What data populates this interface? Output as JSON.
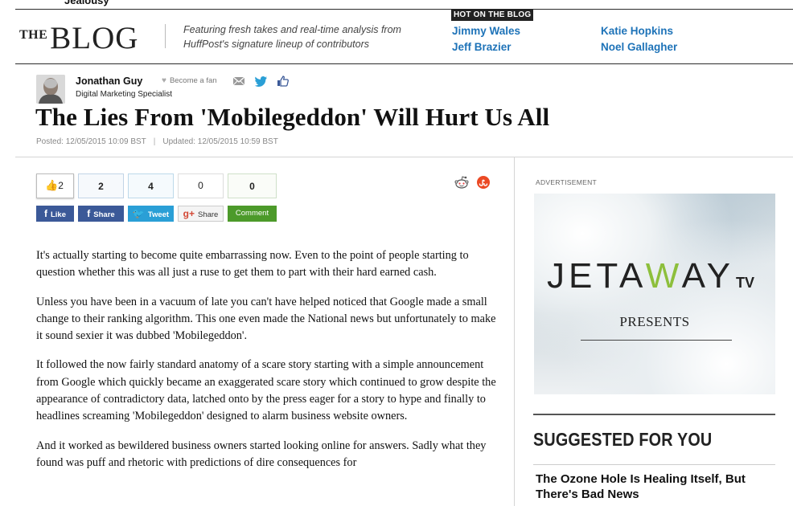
{
  "top_cut_text": "Jealousy",
  "header": {
    "brand_the": "THE",
    "brand_blog": "BLOG",
    "tagline": "Featuring fresh takes and real-time analysis from HuffPost's signature lineup of contributors",
    "hot_label": "HOT ON THE BLOG",
    "hot_links": [
      "Jimmy Wales",
      "Katie Hopkins",
      "Jeff Brazier",
      "Noel Gallagher"
    ]
  },
  "byline": {
    "author_name": "Jonathan Guy",
    "become_fan": "Become a fan",
    "author_title": "Digital Marketing Specialist"
  },
  "article": {
    "title": "The Lies From 'Mobilegeddon' Will Hurt Us All",
    "posted": "Posted: 12/05/2015 10:09 BST",
    "updated": "Updated: 12/05/2015 10:59 BST",
    "paragraphs": [
      "It's actually starting to become quite embarrassing now. Even to the point of people starting to question whether this was all just a ruse to get them to part with their hard earned cash.",
      "Unless you have been in a vacuum of late you can't have helped noticed that Google made a small change to their ranking algorithm. This one even made the National news but unfortunately to make it sound sexier it was dubbed 'Mobilegeddon'.",
      "It followed the now fairly standard anatomy of a scare story starting with a simple announcement from Google which quickly became an exaggerated scare story which continued to grow despite the appearance of contradictory data, latched onto by the press eager for a story to hype and finally to headlines screaming 'Mobilegeddon' designed to alarm business website owners.",
      "And it worked as bewildered business owners started looking online for answers. Sadly what they found was puff and rhetoric with predictions of dire consequences for"
    ]
  },
  "share": {
    "like_count": "2",
    "facebook_count": "2",
    "twitter_count": "4",
    "gplus_count": "0",
    "comment_count": "0",
    "like_label": "Like",
    "share_label": "Share",
    "tweet_label": "Tweet",
    "gplus_label": "Share",
    "comment_label": "Comment",
    "fb_icon": "f",
    "tw_icon": "bird",
    "gp_icon": "g+"
  },
  "sidebar": {
    "advertisement_label": "ADVERTISEMENT",
    "ad_brand_left": "JETA",
    "ad_brand_w": "W",
    "ad_brand_right": "AY",
    "ad_brand_tv": "TV",
    "ad_presents": "PRESENTS",
    "suggested_title": "SUGGESTED FOR YOU",
    "suggested_item": "The Ozone Hole Is Healing Itself, But There's Bad News"
  },
  "colors": {
    "link_blue": "#1e73b8",
    "facebook": "#3b5998",
    "twitter": "#2a9fd6",
    "comment_green": "#4c9a2a",
    "ad_accent_green": "#8dbf3c"
  }
}
